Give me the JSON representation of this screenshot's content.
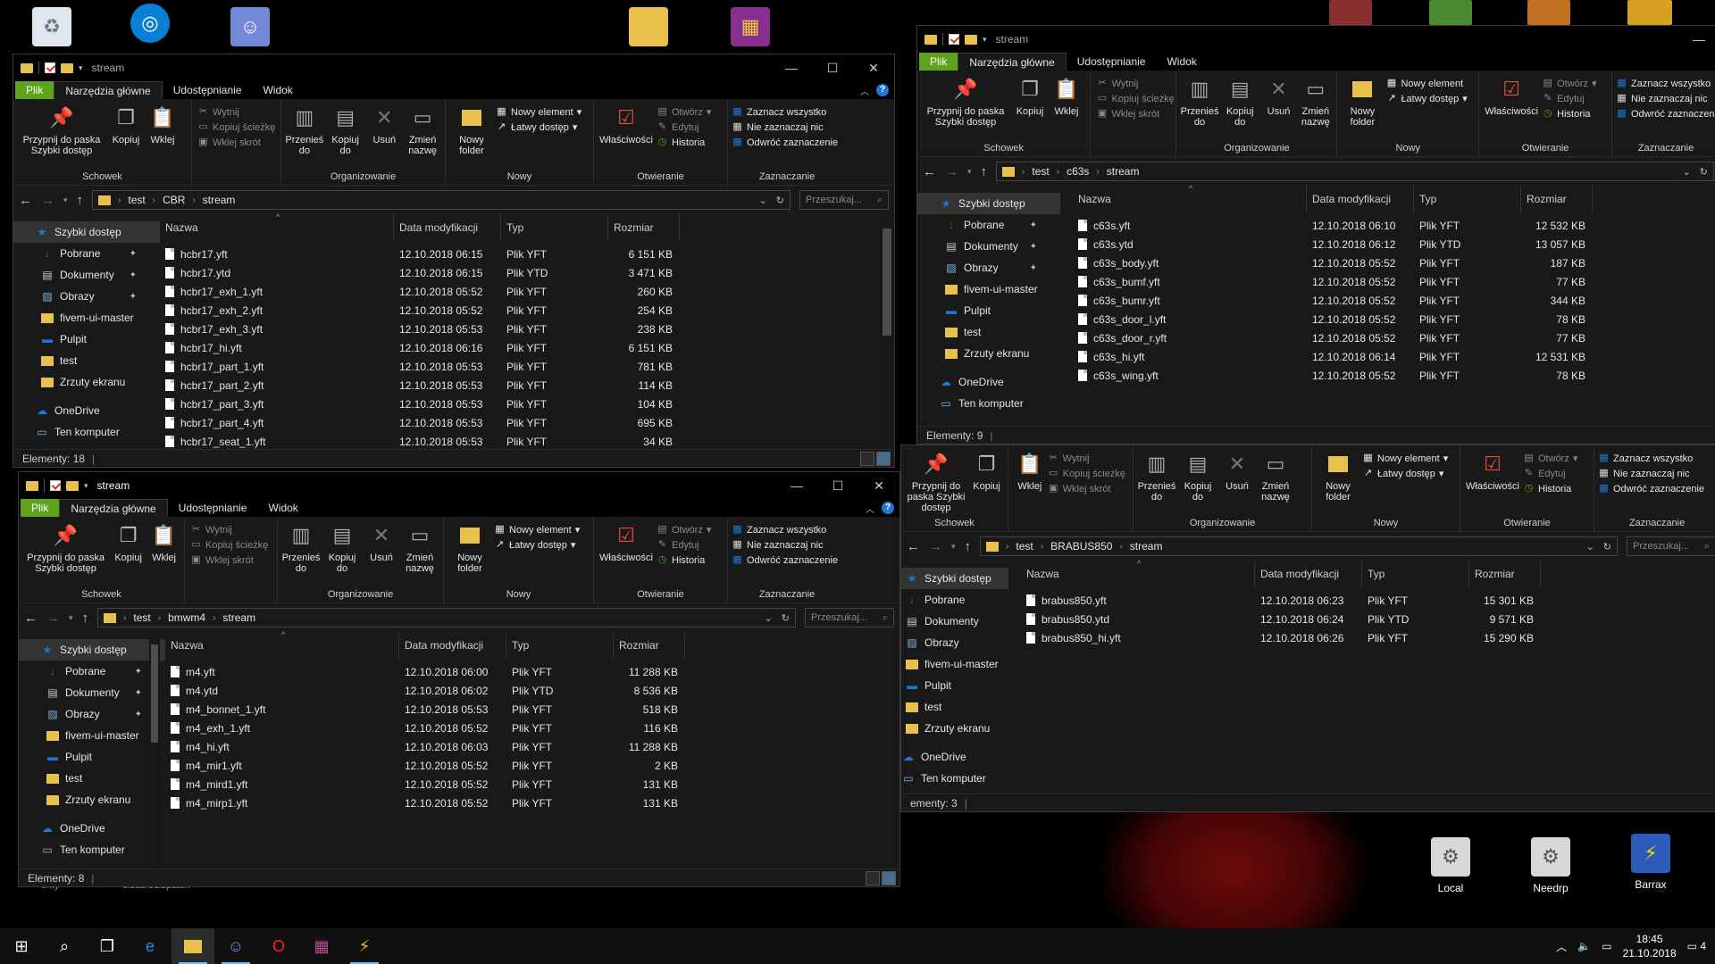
{
  "desktop": {
    "icons": [
      {
        "label": "Local"
      },
      {
        "label": "Needrp"
      },
      {
        "label": "Barrax"
      }
    ],
    "partial_labels": [
      "unty",
      "disabledispatch"
    ]
  },
  "ribbon": {
    "tabs": [
      "Plik",
      "Narzędzia główne",
      "Udostępnianie",
      "Widok"
    ],
    "schowek": {
      "pin": "Przypnij do paska Szybki dostęp",
      "copy": "Kopiuj",
      "paste": "Wklej",
      "cut": "Wytnij",
      "copy_path": "Kopiuj ścieżkę",
      "paste_shortcut": "Wklej skrót",
      "group": "Schowek"
    },
    "organizuj": {
      "move": "Przenieś do",
      "copyto": "Kopiuj do",
      "delete": "Usuń",
      "rename": "Zmień nazwę",
      "group": "Organizowanie"
    },
    "nowy": {
      "new_folder": "Nowy folder",
      "new_item": "Nowy element",
      "easy_access": "Łatwy dostęp",
      "group": "Nowy"
    },
    "otwieranie": {
      "properties": "Właściwości",
      "open": "Otwórz",
      "edit": "Edytuj",
      "history": "Historia",
      "group": "Otwieranie"
    },
    "zaznaczanie": {
      "select_all": "Zaznacz wszystko",
      "select_none": "Nie zaznaczaj nic",
      "invert": "Odwróć zaznaczenie",
      "group": "Zaznaczanie"
    }
  },
  "columns": {
    "name": "Nazwa",
    "date": "Data modyfikacji",
    "type": "Typ",
    "size": "Rozmiar"
  },
  "nav": {
    "quick": "Szybki dostęp",
    "items": [
      "Pobrane",
      "Dokumenty",
      "Obrazy",
      "fivem-ui-master",
      "Pulpit",
      "test",
      "Zrzuty ekranu"
    ],
    "onedrive": "OneDrive",
    "thispc": "Ten komputer"
  },
  "search_placeholder": "Przeszukaj...",
  "windows": {
    "cbr": {
      "title": "stream",
      "path": [
        "test",
        "CBR",
        "stream"
      ],
      "status": "Elementy: 18",
      "files": [
        {
          "name": "hcbr17.yft",
          "date": "12.10.2018 06:15",
          "type": "Plik YFT",
          "size": "6 151 KB"
        },
        {
          "name": "hcbr17.ytd",
          "date": "12.10.2018 06:15",
          "type": "Plik YTD",
          "size": "3 471 KB"
        },
        {
          "name": "hcbr17_exh_1.yft",
          "date": "12.10.2018 05:52",
          "type": "Plik YFT",
          "size": "260 KB"
        },
        {
          "name": "hcbr17_exh_2.yft",
          "date": "12.10.2018 05:52",
          "type": "Plik YFT",
          "size": "254 KB"
        },
        {
          "name": "hcbr17_exh_3.yft",
          "date": "12.10.2018 05:53",
          "type": "Plik YFT",
          "size": "238 KB"
        },
        {
          "name": "hcbr17_hi.yft",
          "date": "12.10.2018 06:16",
          "type": "Plik YFT",
          "size": "6 151 KB"
        },
        {
          "name": "hcbr17_part_1.yft",
          "date": "12.10.2018 05:53",
          "type": "Plik YFT",
          "size": "781 KB"
        },
        {
          "name": "hcbr17_part_2.yft",
          "date": "12.10.2018 05:53",
          "type": "Plik YFT",
          "size": "114 KB"
        },
        {
          "name": "hcbr17_part_3.yft",
          "date": "12.10.2018 05:53",
          "type": "Plik YFT",
          "size": "104 KB"
        },
        {
          "name": "hcbr17_part_4.yft",
          "date": "12.10.2018 05:53",
          "type": "Plik YFT",
          "size": "695 KB"
        },
        {
          "name": "hcbr17_seat_1.yft",
          "date": "12.10.2018 05:53",
          "type": "Plik YFT",
          "size": "34 KB"
        }
      ]
    },
    "c63s": {
      "title": "stream",
      "path": [
        "test",
        "c63s",
        "stream"
      ],
      "status": "Elementy: 9",
      "files": [
        {
          "name": "c63s.yft",
          "date": "12.10.2018 06:10",
          "type": "Plik YFT",
          "size": "12 532 KB"
        },
        {
          "name": "c63s.ytd",
          "date": "12.10.2018 06:12",
          "type": "Plik YTD",
          "size": "13 057 KB"
        },
        {
          "name": "c63s_body.yft",
          "date": "12.10.2018 05:52",
          "type": "Plik YFT",
          "size": "187 KB"
        },
        {
          "name": "c63s_bumf.yft",
          "date": "12.10.2018 05:52",
          "type": "Plik YFT",
          "size": "77 KB"
        },
        {
          "name": "c63s_bumr.yft",
          "date": "12.10.2018 05:52",
          "type": "Plik YFT",
          "size": "344 KB"
        },
        {
          "name": "c63s_door_l.yft",
          "date": "12.10.2018 05:52",
          "type": "Plik YFT",
          "size": "78 KB"
        },
        {
          "name": "c63s_door_r.yft",
          "date": "12.10.2018 05:52",
          "type": "Plik YFT",
          "size": "77 KB"
        },
        {
          "name": "c63s_hi.yft",
          "date": "12.10.2018 06:14",
          "type": "Plik YFT",
          "size": "12 531 KB"
        },
        {
          "name": "c63s_wing.yft",
          "date": "12.10.2018 05:52",
          "type": "Plik YFT",
          "size": "78 KB"
        }
      ]
    },
    "bmw": {
      "title": "stream",
      "path": [
        "test",
        "bmwm4",
        "stream"
      ],
      "status": "Elementy: 8",
      "files": [
        {
          "name": "m4.yft",
          "date": "12.10.2018 06:00",
          "type": "Plik YFT",
          "size": "11 288 KB"
        },
        {
          "name": "m4.ytd",
          "date": "12.10.2018 06:02",
          "type": "Plik YTD",
          "size": "8 536 KB"
        },
        {
          "name": "m4_bonnet_1.yft",
          "date": "12.10.2018 05:53",
          "type": "Plik YFT",
          "size": "518 KB"
        },
        {
          "name": "m4_exh_1.yft",
          "date": "12.10.2018 05:52",
          "type": "Plik YFT",
          "size": "116 KB"
        },
        {
          "name": "m4_hi.yft",
          "date": "12.10.2018 06:03",
          "type": "Plik YFT",
          "size": "11 288 KB"
        },
        {
          "name": "m4_mir1.yft",
          "date": "12.10.2018 05:52",
          "type": "Plik YFT",
          "size": "2 KB"
        },
        {
          "name": "m4_mird1.yft",
          "date": "12.10.2018 05:52",
          "type": "Plik YFT",
          "size": "131 KB"
        },
        {
          "name": "m4_mirp1.yft",
          "date": "12.10.2018 05:52",
          "type": "Plik YFT",
          "size": "131 KB"
        }
      ]
    },
    "brabus": {
      "path": [
        "test",
        "BRABUS850",
        "stream"
      ],
      "status": "ementy: 3",
      "files": [
        {
          "name": "brabus850.yft",
          "date": "12.10.2018 06:23",
          "type": "Plik YFT",
          "size": "15 301 KB"
        },
        {
          "name": "brabus850.ytd",
          "date": "12.10.2018 06:24",
          "type": "Plik YTD",
          "size": "9 571 KB"
        },
        {
          "name": "brabus850_hi.yft",
          "date": "12.10.2018 06:26",
          "type": "Plik YFT",
          "size": "15 290 KB"
        }
      ]
    }
  },
  "taskbar": {
    "time": "18:45",
    "date": "21.10.2018",
    "notification_count": "4"
  },
  "colors": {
    "file_tab": "#5ea31c",
    "folder": "#e8c04c",
    "accent": "#1e78d2"
  }
}
